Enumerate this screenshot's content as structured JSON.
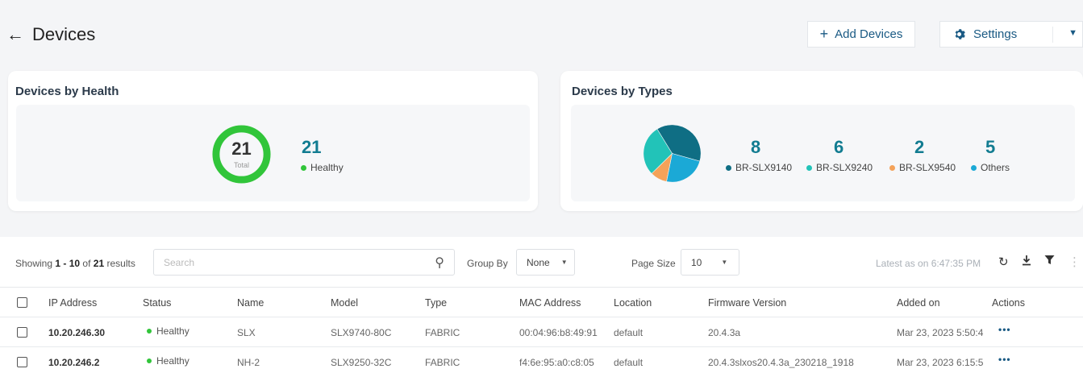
{
  "header": {
    "title": "Devices",
    "add_button": "Add Devices",
    "settings_button": "Settings"
  },
  "health_card": {
    "title": "Devices by Health",
    "total_value": "21",
    "total_label": "Total",
    "healthy_count": "21",
    "healthy_label": "Healthy",
    "colors": {
      "healthy": "#31c53a"
    }
  },
  "types_card": {
    "title": "Devices by Types",
    "items": [
      {
        "count": "8",
        "label": "BR-SLX9140",
        "color": "#0f6e84"
      },
      {
        "count": "6",
        "label": "BR-SLX9240",
        "color": "#22c3b8"
      },
      {
        "count": "2",
        "label": "BR-SLX9540",
        "color": "#f4a259"
      },
      {
        "count": "5",
        "label": "Others",
        "color": "#1ba9d6"
      }
    ]
  },
  "toolbar": {
    "showing_prefix": "Showing",
    "range": "1 - 10",
    "of": "of",
    "total": "21",
    "results": "results",
    "search_placeholder": "Search",
    "group_by_label": "Group By",
    "group_by_value": "None",
    "page_size_label": "Page Size",
    "page_size_value": "10",
    "latest": "Latest as on 6:47:35 PM"
  },
  "table": {
    "columns": [
      "IP Address",
      "Status",
      "Name",
      "Model",
      "Type",
      "MAC Address",
      "Location",
      "Firmware Version",
      "Added on",
      "Actions"
    ],
    "rows": [
      {
        "ip": "10.20.246.30",
        "status": "Healthy",
        "name": "SLX",
        "model": "SLX9740-80C",
        "type": "FABRIC",
        "mac": "00:04:96:b8:49:91",
        "location": "default",
        "firmware": "20.4.3a",
        "added": "Mar 23, 2023 5:50:4",
        "actions": "•••"
      },
      {
        "ip": "10.20.246.2",
        "status": "Healthy",
        "name": "NH-2",
        "model": "SLX9250-32C",
        "type": "FABRIC",
        "mac": "f4:6e:95:a0:c8:05",
        "location": "default",
        "firmware": "20.4.3slxos20.4.3a_230218_1918",
        "added": "Mar 23, 2023 6:15:5",
        "actions": "•••"
      }
    ]
  }
}
